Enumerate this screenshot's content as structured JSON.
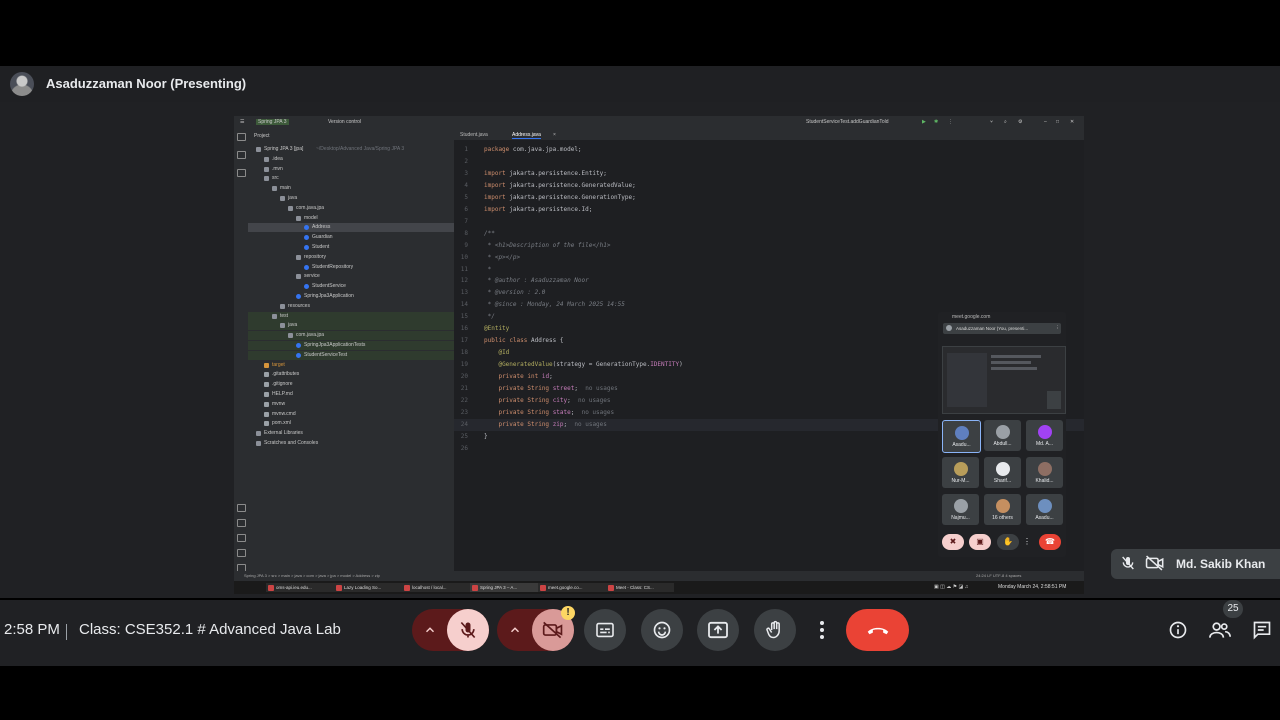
{
  "presenter": {
    "name": "Asaduzzaman Noor (Presenting)"
  },
  "ide": {
    "project_name": "Spring JPA 3",
    "vcs": "Version control",
    "run_config": "StudentServiceTest.addGuardianTold",
    "panel_title": "Project",
    "tabs": [
      "Student.java",
      "Address.java"
    ],
    "tree": [
      {
        "label": "Spring JPA 3 [jpa]",
        "depth": 0,
        "kind": "folder",
        "hint": "~/Desktop/Advanced Java/Spring JPA 3"
      },
      {
        "label": ".idea",
        "depth": 1,
        "kind": "folder"
      },
      {
        "label": ".mvn",
        "depth": 1,
        "kind": "folder"
      },
      {
        "label": "src",
        "depth": 1,
        "kind": "folder"
      },
      {
        "label": "main",
        "depth": 2,
        "kind": "folder"
      },
      {
        "label": "java",
        "depth": 3,
        "kind": "folder"
      },
      {
        "label": "com.java.jpa",
        "depth": 4,
        "kind": "package"
      },
      {
        "label": "model",
        "depth": 5,
        "kind": "package"
      },
      {
        "label": "Address",
        "depth": 6,
        "kind": "class",
        "selected": true
      },
      {
        "label": "Guardian",
        "depth": 6,
        "kind": "class"
      },
      {
        "label": "Student",
        "depth": 6,
        "kind": "class"
      },
      {
        "label": "repository",
        "depth": 5,
        "kind": "package"
      },
      {
        "label": "StudentRepository",
        "depth": 6,
        "kind": "class"
      },
      {
        "label": "service",
        "depth": 5,
        "kind": "package"
      },
      {
        "label": "StudentService",
        "depth": 6,
        "kind": "class"
      },
      {
        "label": "SpringJpa3Application",
        "depth": 5,
        "kind": "class"
      },
      {
        "label": "resources",
        "depth": 3,
        "kind": "folder"
      },
      {
        "label": "test",
        "depth": 2,
        "kind": "folder",
        "green": true
      },
      {
        "label": "java",
        "depth": 3,
        "kind": "folder",
        "green": true
      },
      {
        "label": "com.java.jpa",
        "depth": 4,
        "kind": "package",
        "green": true
      },
      {
        "label": "SpringJpa3ApplicationTests",
        "depth": 5,
        "kind": "class",
        "green": true
      },
      {
        "label": "StudentServiceTest",
        "depth": 5,
        "kind": "class",
        "green": true
      },
      {
        "label": "target",
        "depth": 1,
        "kind": "folder-orange"
      },
      {
        "label": ".gitattributes",
        "depth": 1,
        "kind": "file"
      },
      {
        "label": ".gitignore",
        "depth": 1,
        "kind": "file"
      },
      {
        "label": "HELP.md",
        "depth": 1,
        "kind": "file"
      },
      {
        "label": "mvnw",
        "depth": 1,
        "kind": "file"
      },
      {
        "label": "mvnw.cmd",
        "depth": 1,
        "kind": "file"
      },
      {
        "label": "pom.xml",
        "depth": 1,
        "kind": "file"
      },
      {
        "label": "External Libraries",
        "depth": 0,
        "kind": "lib"
      },
      {
        "label": "Scratches and Consoles",
        "depth": 0,
        "kind": "lib"
      }
    ],
    "code_lines": [
      {
        "n": "1",
        "text": "package com.java.jpa.model;"
      },
      {
        "n": "2",
        "text": ""
      },
      {
        "n": "3",
        "text": "import jakarta.persistence.Entity;"
      },
      {
        "n": "4",
        "text": "import jakarta.persistence.GeneratedValue;"
      },
      {
        "n": "5",
        "text": "import jakarta.persistence.GenerationType;"
      },
      {
        "n": "6",
        "text": "import jakarta.persistence.Id;"
      },
      {
        "n": "7",
        "text": ""
      },
      {
        "n": "8",
        "text": "/**"
      },
      {
        "n": "9",
        "text": " * <h1>Description of the file</h1>"
      },
      {
        "n": "10",
        "text": " * <p></p>"
      },
      {
        "n": "11",
        "text": " *"
      },
      {
        "n": "12",
        "text": " * @author : Asaduzzaman Noor"
      },
      {
        "n": "13",
        "text": " * @version : 2.0"
      },
      {
        "n": "14",
        "text": " * @since : Monday, 24 March 2025 14:55"
      },
      {
        "n": "15",
        "text": " */"
      },
      {
        "n": "16",
        "text": "@Entity"
      },
      {
        "n": "17",
        "text": "public class Address {"
      },
      {
        "n": "18",
        "text": "    @Id"
      },
      {
        "n": "19",
        "text": "    @GeneratedValue(strategy = GenerationType.IDENTITY)"
      },
      {
        "n": "20",
        "text": "    private int id;"
      },
      {
        "n": "21",
        "text": "    private String street;",
        "hint": "no usages"
      },
      {
        "n": "22",
        "text": "    private String city;",
        "hint": "no usages"
      },
      {
        "n": "23",
        "text": "    private String state;",
        "hint": "no usages"
      },
      {
        "n": "24",
        "text": "    private String zip;",
        "hint": "no usages",
        "current": true
      },
      {
        "n": "25",
        "text": "}"
      },
      {
        "n": "26",
        "text": ""
      }
    ],
    "breadcrumb": "Spring JPA 3 > src > main > java > com > java > jpa > model > Address > zip",
    "status_right": "24:24   LF   UTF-8   4 spaces",
    "taskbar": [
      {
        "label": "oms-api.ieu.edu...",
        "active": false
      },
      {
        "label": "Lazy Loading So...",
        "active": false
      },
      {
        "label": "localhost / local...",
        "active": false
      },
      {
        "label": "Spring JPA 3 – A...",
        "active": true
      },
      {
        "label": "meet.google.co...",
        "active": false
      },
      {
        "label": "Meet - Class: CS...",
        "active": false
      }
    ],
    "clock_text": "Monday March 24, 2:58:51 PM"
  },
  "meet_popup": {
    "url": "meet.google.com",
    "title": "Asaduzzaman Noor (You, presenti...",
    "tiles": [
      "Asadu...",
      "Abdull...",
      "Md. A...",
      "Nur-M...",
      "Sharif...",
      "Khalid...",
      "Najmu...",
      "16 others",
      "Asadu..."
    ]
  },
  "self_tile": {
    "name": "Md. Sakib Khan"
  },
  "controls": {
    "time": "2:58 PM",
    "meeting_title": "Class: CSE352.1 # Advanced Java Lab",
    "people_count": "25",
    "warning": "!"
  },
  "colors": {
    "accent_blue": "#8ab4f8",
    "end_call_red": "#ea4335",
    "muted_pink": "#f6cfcd",
    "muted_dark_red": "#5c1a1b"
  }
}
